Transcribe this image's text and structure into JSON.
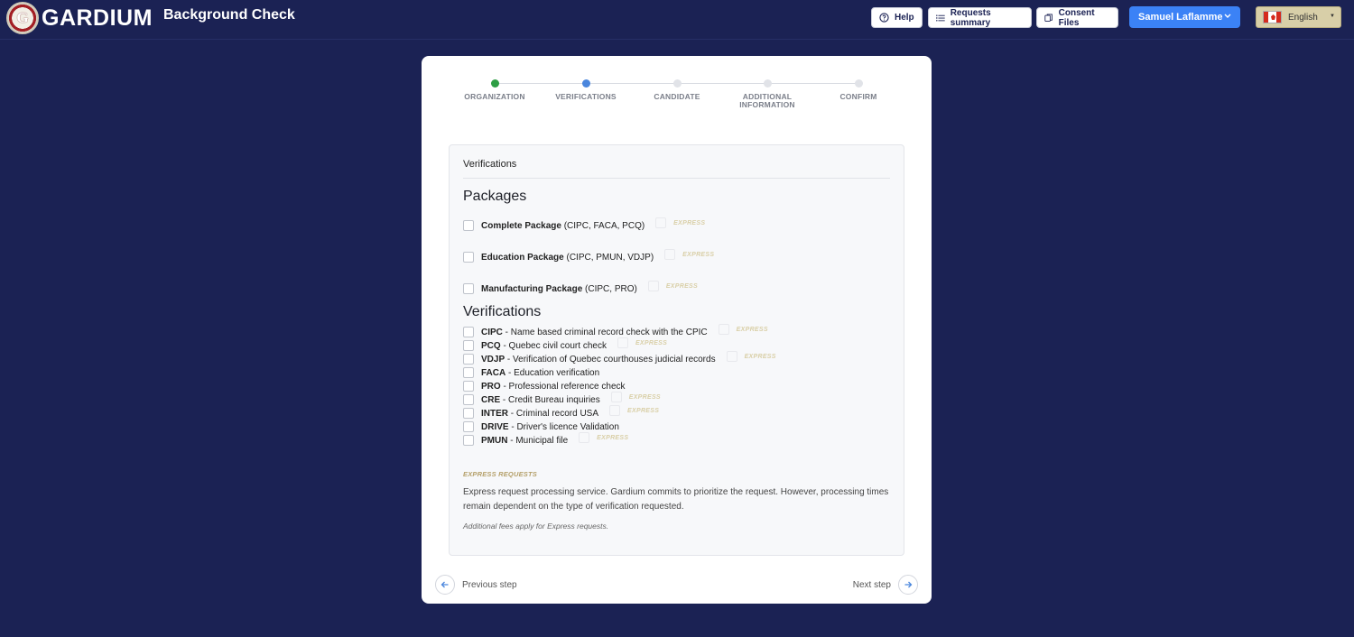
{
  "header": {
    "logo_letter": "G",
    "brand": "GARDIUM",
    "app_title": "Background Check",
    "help_label": "Help",
    "requests_summary_label": "Requests summary",
    "consent_files_label": "Consent Files",
    "user_name": "Samuel Laflamme",
    "language": "English"
  },
  "stepper": {
    "steps": [
      {
        "label": "ORGANIZATION",
        "state": "done"
      },
      {
        "label": "VERIFICATIONS",
        "state": "active"
      },
      {
        "label": "CANDIDATE",
        "state": "pending"
      },
      {
        "label": "ADDITIONAL INFORMATION",
        "state": "pending"
      },
      {
        "label": "CONFIRM",
        "state": "pending"
      }
    ]
  },
  "panel": {
    "title": "Verifications",
    "packages_heading": "Packages",
    "packages": [
      {
        "name": "Complete Package",
        "codes": "(CIPC, FACA, PCQ)",
        "express": "EXPRESS"
      },
      {
        "name": "Education Package",
        "codes": "(CIPC, PMUN, VDJP)",
        "express": "EXPRESS"
      },
      {
        "name": "Manufacturing Package",
        "codes": "(CIPC, PRO)",
        "express": "EXPRESS"
      }
    ],
    "verifications_heading": "Verifications",
    "verifications": [
      {
        "code": "CIPC",
        "desc": " - Name based criminal record check with the CPIC",
        "express": "EXPRESS"
      },
      {
        "code": "PCQ",
        "desc": " - Quebec civil court check",
        "express": "EXPRESS"
      },
      {
        "code": "VDJP",
        "desc": " - Verification of Quebec courthouses judicial records",
        "express": "EXPRESS"
      },
      {
        "code": "FACA",
        "desc": " - Education verification",
        "express": ""
      },
      {
        "code": "PRO",
        "desc": " - Professional reference check",
        "express": ""
      },
      {
        "code": "CRE",
        "desc": " - Credit Bureau inquiries",
        "express": "EXPRESS"
      },
      {
        "code": "INTER",
        "desc": " - Criminal record USA",
        "express": "EXPRESS"
      },
      {
        "code": "DRIVE",
        "desc": " - Driver's licence Validation",
        "express": ""
      },
      {
        "code": "PMUN",
        "desc": " - Municipal file",
        "express": "EXPRESS"
      }
    ],
    "express_title": "EXPRESS REQUESTS",
    "express_desc": "Express request processing service. Gardium commits to prioritize the request. However, processing times remain dependent on the type of verification requested.",
    "express_fees": "Additional fees apply for Express requests."
  },
  "nav": {
    "previous_label": "Previous step",
    "next_label": "Next step"
  },
  "colors": {
    "background": "#1b2254",
    "primary": "#3b82f6",
    "step_done": "#2e9e45",
    "step_active": "#4a86dd",
    "express_gold": "#b5a06a"
  }
}
